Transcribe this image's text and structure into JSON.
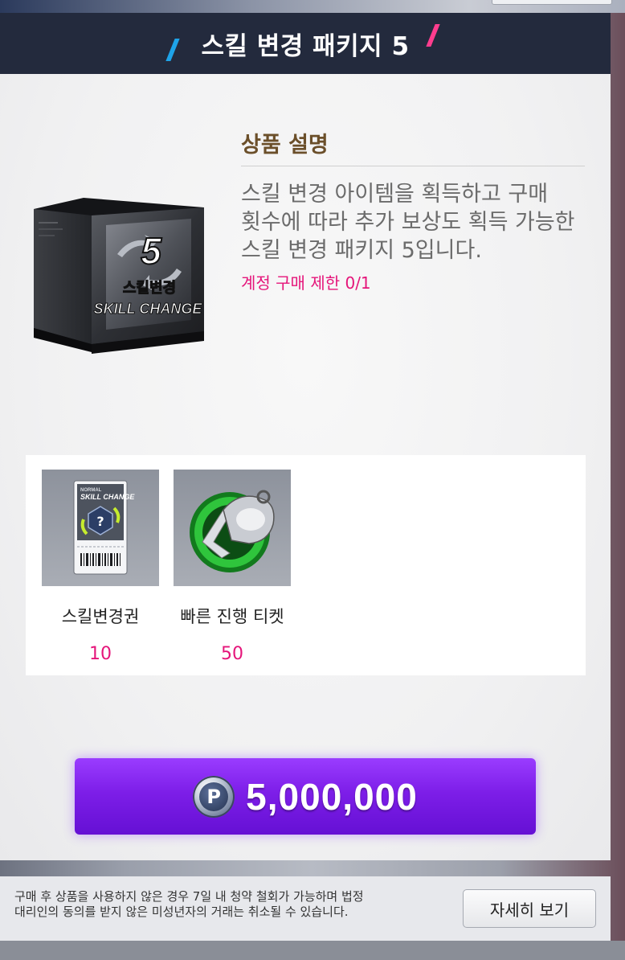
{
  "modal": {
    "title": "스킬 변경 패키지 5"
  },
  "product": {
    "box_number": "5",
    "box_label_kr": "스킬변경",
    "box_label_en": "SKILL CHANGE"
  },
  "description": {
    "heading": "상품 설명",
    "lines": [
      "스킬 변경 아이템을 획득하고 구매",
      "횟수에 따라 추가 보상도 획득 가능한",
      "스킬 변경 패키지 5입니다."
    ],
    "limit": "계정 구매 제한 0/1"
  },
  "items": [
    {
      "name": "스킬변경권",
      "quantity": "10",
      "icon": "skill-change-ticket-icon",
      "ticket_tag": "NORMAL",
      "ticket_title": "SKILL CHANGE"
    },
    {
      "name": "빠른 진행 티켓",
      "quantity": "50",
      "icon": "whistle-icon"
    }
  ],
  "purchase": {
    "currency_symbol": "P",
    "price": "5,000,000",
    "currency_icon": "p-coin-icon"
  },
  "footer": {
    "notice_line1": "구매 후 상품을 사용하지 않은 경우 7일 내 청약 철회가 가능하며 법정",
    "notice_line2": "대리인의 동의를 받지 않은 미성년자의 거래는 취소될 수 있습니다.",
    "detail_button": "자세히 보기"
  },
  "colors": {
    "header_bg": "#232a3d",
    "accent_pink": "#e5157a",
    "purchase_purple": "#7d1ee8",
    "heading_brown": "#6b4f2a"
  }
}
